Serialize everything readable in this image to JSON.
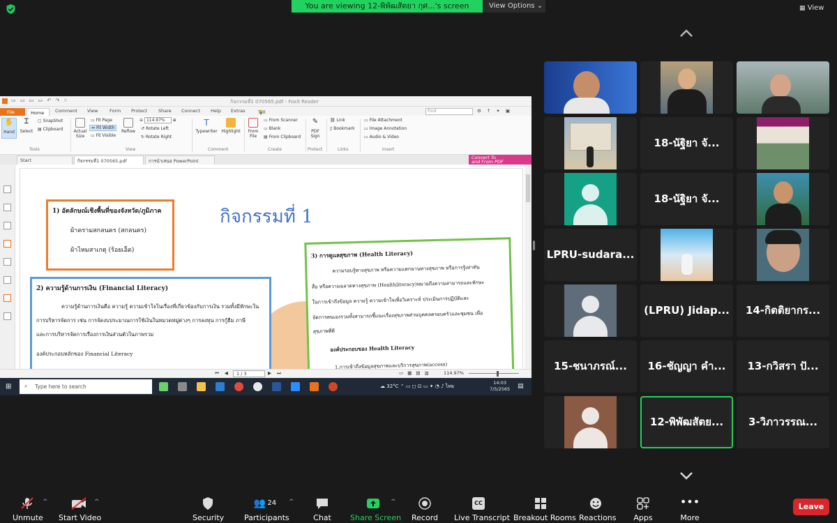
{
  "top_bar": {
    "viewing_banner": "You are viewing 12-พิพัฒสัตยา กุศ...'s screen",
    "view_options": "View Options",
    "view_button": "View"
  },
  "foxit": {
    "window_title": "กิจกรรมที่1 070565.pdf - Foxit Reader",
    "menu_tabs": [
      "File",
      "Home",
      "Comment",
      "View",
      "Form",
      "Protect",
      "Share",
      "Connect",
      "Help",
      "Extras"
    ],
    "tell_me": "Tell me what you want to do...",
    "find_placeholder": "Find",
    "ribbon": {
      "hand": "Hand",
      "select": "Select",
      "snapshot": "SnapShot",
      "clipboard": "Clipboard",
      "actual_size": "Actual Size",
      "fit_page": "Fit Page",
      "fit_width": "Fit Width",
      "fit_visible": "Fit Visible",
      "reflow": "Reflow",
      "zoom": "114.97%",
      "rotate_left": "Rotate Left",
      "rotate_right": "Rotate Right",
      "typewriter": "Typewriter",
      "highlight": "Highlight",
      "from_file": "From File",
      "from_scanner": "From Scanner",
      "blank": "Blank",
      "from_clipboard": "From Clipboard",
      "pdf_sign": "PDF Sign",
      "link": "Link",
      "bookmark": "Bookmark",
      "file_attachment": "File Attachment",
      "image_annotation": "Image Annotation",
      "audio_video": "Audio & Video",
      "groups": [
        "Tools",
        "View",
        "Comment",
        "Create",
        "Protect",
        "Links",
        "Insert"
      ]
    },
    "doc_tabs": [
      "Start",
      "กิจกรรมที่1 070565.pdf",
      "การนำเสนอ PowerPoint"
    ],
    "convert_banner_1": "Convert To",
    "convert_banner_2": "and From PDF",
    "page_indicator": "1 / 3",
    "status_zoom": "114.97%"
  },
  "slide": {
    "title": "กิจกรรมที่ 1",
    "box1_heading": "1) อัตลักษณ์เชิงพื้นที่ของจังหวัด/ภูมิภาค",
    "box1_line1": "ผ้าครามสกลนคร (สกลนคร)",
    "box1_line2": "ผ้าไหมสาเกตุ (ร้อยเอ็ด)",
    "box2_heading": "2) ความรู้ด้านการเงิน (Financial Literacy)",
    "box2_para_1": "ความรู้ด้านการเงินคือ ความรู้ ความเข้าใจในเรื่องที่เกี่ยวข้องกับการเงิน รวมทั้งมีทักษะใน",
    "box2_para_2": "การบริหารจัดการ เช่น การจัดงบประมาณการใช้เงินในหมวดหมู่ต่างๆ การลงทุน การกู้ยืม ภาษี",
    "box2_para_3": "และการบริหารจัดการเรื่องการเงินส่วนตัวในภาพรวม",
    "box2_components": "องค์ประกอบหลักของ Financial Literacy",
    "box3_heading": "3) การดูแลสุขภาพ (Health Literacy)",
    "box3_para_1": "ความรอบรู้ทางสุขภาพ หรือความแตกฉานทางสุขภาพ หรือการรู้เท่าทัน",
    "box3_para_2": "สื่อ หรือความฉลาดทางสุขภาพ (Healthliteracy)หมายถึงความสามารถและทักษะ",
    "box3_para_3": "ในการเข้าถึงข้อมูล ความรู้ ความเข้าใจเพื่อวิเคราะห์ ประเมินการปฏิบัติและ",
    "box3_para_4": "จัดการตนเองรวมทั้งสามารถชี้แนะเรื่องสุขภาพส่วนบุคคลครอบครัวและชุมชน เพื่อ",
    "box3_para_5": "สุขภาพที่ดี",
    "box3_components": "องค์ประกอบของ Health Literacy",
    "box3_item1": "1.การเข้าถึงข้อมูลสุขภาพและบริการสุขภาพ(access)"
  },
  "windows_taskbar": {
    "search_placeholder": "Type here to search",
    "weather": "32°C",
    "lang": "ไทย",
    "time": "14:03",
    "date": "7/5/2565"
  },
  "gallery": {
    "names": {
      "r1": "18-นัฐิยา จั...",
      "r2": "18-นัฐิยา จั...",
      "r3": "LPRU-sudara...",
      "r4a": "(LPRU) Jidap...",
      "r4b": "14-กิตติยากร...",
      "r5a": "15-ชนาภรณ์...",
      "r5b": "16-ชัญญา คำ...",
      "r5c": "13-กวิสรา ปั...",
      "r6b": "12-พิพัฒสัตย...",
      "r6c": "3-วิภาวรรณ..."
    },
    "active_speaker_color": "#23d160"
  },
  "toolbar": {
    "unmute": "Unmute",
    "start_video": "Start Video",
    "security": "Security",
    "participants": "Participants",
    "participants_count": "24",
    "chat": "Chat",
    "share_screen": "Share Screen",
    "record": "Record",
    "live_transcript": "Live Transcript",
    "breakout_rooms": "Breakout Rooms",
    "reactions": "Reactions",
    "apps": "Apps",
    "more": "More",
    "leave": "Leave"
  }
}
